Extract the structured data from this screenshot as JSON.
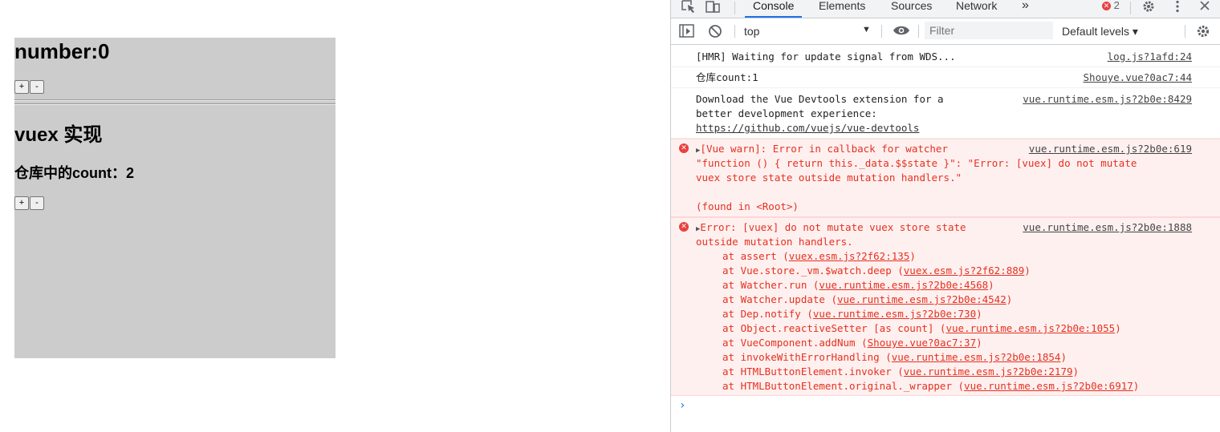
{
  "page": {
    "counter_label": "number:0",
    "vuex_title": "vuex 实现",
    "store_count_label": "仓库中的count：2",
    "plus_label": "+",
    "minus_label": "-"
  },
  "devtools": {
    "tabs": [
      "Console",
      "Elements",
      "Sources",
      "Network"
    ],
    "more_tabs": "»",
    "error_count": "2",
    "context": "top",
    "filter_placeholder": "Filter",
    "levels": "Default levels ▾",
    "messages": [
      {
        "text": "[HMR] Waiting for update signal from WDS...",
        "source": "log.js?1afd:24"
      },
      {
        "text": "仓库count:1",
        "source": "Shouye.vue?0ac7:44"
      },
      {
        "lines": [
          "Download the Vue Devtools extension for a",
          "better development experience:"
        ],
        "link": "https://github.com/vuejs/vue-devtools",
        "source": "vue.runtime.esm.js?2b0e:8429"
      }
    ],
    "warn": {
      "lines": [
        "[Vue warn]: Error in callback for watcher",
        "\"function () { return this._data.$$state }\": \"Error: [vuex] do not mutate",
        "vuex store state outside mutation handlers.\"",
        "",
        "(found in <Root>)"
      ],
      "source": "vue.runtime.esm.js?2b0e:619"
    },
    "error": {
      "lines": [
        "Error: [vuex] do not mutate vuex store state",
        "outside mutation handlers."
      ],
      "source": "vue.runtime.esm.js?2b0e:1888",
      "stack": [
        {
          "fn": "at assert",
          "loc": "vuex.esm.js?2f62:135"
        },
        {
          "fn": "at Vue.store._vm.$watch.deep",
          "loc": "vuex.esm.js?2f62:889"
        },
        {
          "fn": "at Watcher.run",
          "loc": "vue.runtime.esm.js?2b0e:4568"
        },
        {
          "fn": "at Watcher.update",
          "loc": "vue.runtime.esm.js?2b0e:4542"
        },
        {
          "fn": "at Dep.notify",
          "loc": "vue.runtime.esm.js?2b0e:730"
        },
        {
          "fn": "at Object.reactiveSetter [as count]",
          "loc": "vue.runtime.esm.js?2b0e:1055"
        },
        {
          "fn": "at VueComponent.addNum",
          "loc": "Shouye.vue?0ac7:37"
        },
        {
          "fn": "at invokeWithErrorHandling",
          "loc": "vue.runtime.esm.js?2b0e:1854"
        },
        {
          "fn": "at HTMLButtonElement.invoker",
          "loc": "vue.runtime.esm.js?2b0e:2179"
        },
        {
          "fn": "at HTMLButtonElement.original._wrapper",
          "loc": "vue.runtime.esm.js?2b0e:6917"
        }
      ]
    },
    "prompt": "›"
  }
}
